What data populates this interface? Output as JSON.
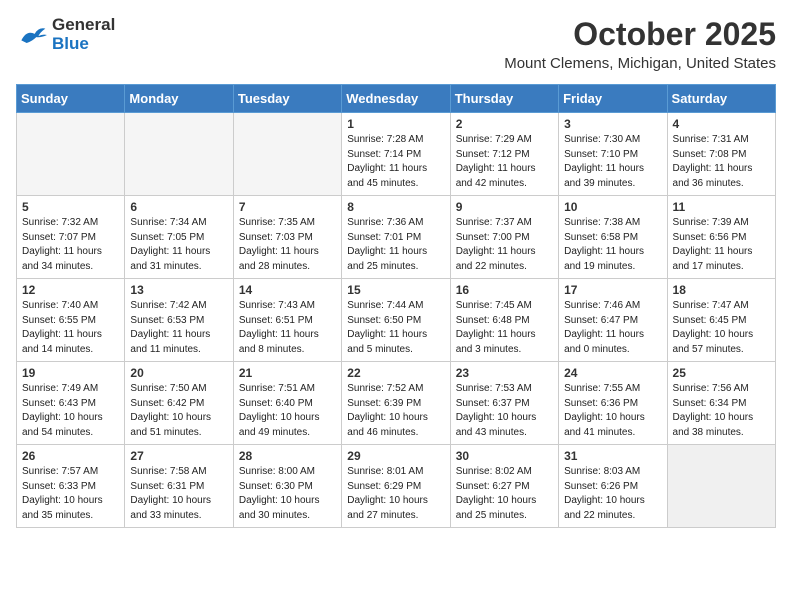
{
  "logo": {
    "line1": "General",
    "line2": "Blue"
  },
  "header": {
    "month": "October 2025",
    "location": "Mount Clemens, Michigan, United States"
  },
  "days_of_week": [
    "Sunday",
    "Monday",
    "Tuesday",
    "Wednesday",
    "Thursday",
    "Friday",
    "Saturday"
  ],
  "weeks": [
    [
      {
        "day": "",
        "info": ""
      },
      {
        "day": "",
        "info": ""
      },
      {
        "day": "",
        "info": ""
      },
      {
        "day": "1",
        "info": "Sunrise: 7:28 AM\nSunset: 7:14 PM\nDaylight: 11 hours\nand 45 minutes."
      },
      {
        "day": "2",
        "info": "Sunrise: 7:29 AM\nSunset: 7:12 PM\nDaylight: 11 hours\nand 42 minutes."
      },
      {
        "day": "3",
        "info": "Sunrise: 7:30 AM\nSunset: 7:10 PM\nDaylight: 11 hours\nand 39 minutes."
      },
      {
        "day": "4",
        "info": "Sunrise: 7:31 AM\nSunset: 7:08 PM\nDaylight: 11 hours\nand 36 minutes."
      }
    ],
    [
      {
        "day": "5",
        "info": "Sunrise: 7:32 AM\nSunset: 7:07 PM\nDaylight: 11 hours\nand 34 minutes."
      },
      {
        "day": "6",
        "info": "Sunrise: 7:34 AM\nSunset: 7:05 PM\nDaylight: 11 hours\nand 31 minutes."
      },
      {
        "day": "7",
        "info": "Sunrise: 7:35 AM\nSunset: 7:03 PM\nDaylight: 11 hours\nand 28 minutes."
      },
      {
        "day": "8",
        "info": "Sunrise: 7:36 AM\nSunset: 7:01 PM\nDaylight: 11 hours\nand 25 minutes."
      },
      {
        "day": "9",
        "info": "Sunrise: 7:37 AM\nSunset: 7:00 PM\nDaylight: 11 hours\nand 22 minutes."
      },
      {
        "day": "10",
        "info": "Sunrise: 7:38 AM\nSunset: 6:58 PM\nDaylight: 11 hours\nand 19 minutes."
      },
      {
        "day": "11",
        "info": "Sunrise: 7:39 AM\nSunset: 6:56 PM\nDaylight: 11 hours\nand 17 minutes."
      }
    ],
    [
      {
        "day": "12",
        "info": "Sunrise: 7:40 AM\nSunset: 6:55 PM\nDaylight: 11 hours\nand 14 minutes."
      },
      {
        "day": "13",
        "info": "Sunrise: 7:42 AM\nSunset: 6:53 PM\nDaylight: 11 hours\nand 11 minutes."
      },
      {
        "day": "14",
        "info": "Sunrise: 7:43 AM\nSunset: 6:51 PM\nDaylight: 11 hours\nand 8 minutes."
      },
      {
        "day": "15",
        "info": "Sunrise: 7:44 AM\nSunset: 6:50 PM\nDaylight: 11 hours\nand 5 minutes."
      },
      {
        "day": "16",
        "info": "Sunrise: 7:45 AM\nSunset: 6:48 PM\nDaylight: 11 hours\nand 3 minutes."
      },
      {
        "day": "17",
        "info": "Sunrise: 7:46 AM\nSunset: 6:47 PM\nDaylight: 11 hours\nand 0 minutes."
      },
      {
        "day": "18",
        "info": "Sunrise: 7:47 AM\nSunset: 6:45 PM\nDaylight: 10 hours\nand 57 minutes."
      }
    ],
    [
      {
        "day": "19",
        "info": "Sunrise: 7:49 AM\nSunset: 6:43 PM\nDaylight: 10 hours\nand 54 minutes."
      },
      {
        "day": "20",
        "info": "Sunrise: 7:50 AM\nSunset: 6:42 PM\nDaylight: 10 hours\nand 51 minutes."
      },
      {
        "day": "21",
        "info": "Sunrise: 7:51 AM\nSunset: 6:40 PM\nDaylight: 10 hours\nand 49 minutes."
      },
      {
        "day": "22",
        "info": "Sunrise: 7:52 AM\nSunset: 6:39 PM\nDaylight: 10 hours\nand 46 minutes."
      },
      {
        "day": "23",
        "info": "Sunrise: 7:53 AM\nSunset: 6:37 PM\nDaylight: 10 hours\nand 43 minutes."
      },
      {
        "day": "24",
        "info": "Sunrise: 7:55 AM\nSunset: 6:36 PM\nDaylight: 10 hours\nand 41 minutes."
      },
      {
        "day": "25",
        "info": "Sunrise: 7:56 AM\nSunset: 6:34 PM\nDaylight: 10 hours\nand 38 minutes."
      }
    ],
    [
      {
        "day": "26",
        "info": "Sunrise: 7:57 AM\nSunset: 6:33 PM\nDaylight: 10 hours\nand 35 minutes."
      },
      {
        "day": "27",
        "info": "Sunrise: 7:58 AM\nSunset: 6:31 PM\nDaylight: 10 hours\nand 33 minutes."
      },
      {
        "day": "28",
        "info": "Sunrise: 8:00 AM\nSunset: 6:30 PM\nDaylight: 10 hours\nand 30 minutes."
      },
      {
        "day": "29",
        "info": "Sunrise: 8:01 AM\nSunset: 6:29 PM\nDaylight: 10 hours\nand 27 minutes."
      },
      {
        "day": "30",
        "info": "Sunrise: 8:02 AM\nSunset: 6:27 PM\nDaylight: 10 hours\nand 25 minutes."
      },
      {
        "day": "31",
        "info": "Sunrise: 8:03 AM\nSunset: 6:26 PM\nDaylight: 10 hours\nand 22 minutes."
      },
      {
        "day": "",
        "info": ""
      }
    ]
  ]
}
